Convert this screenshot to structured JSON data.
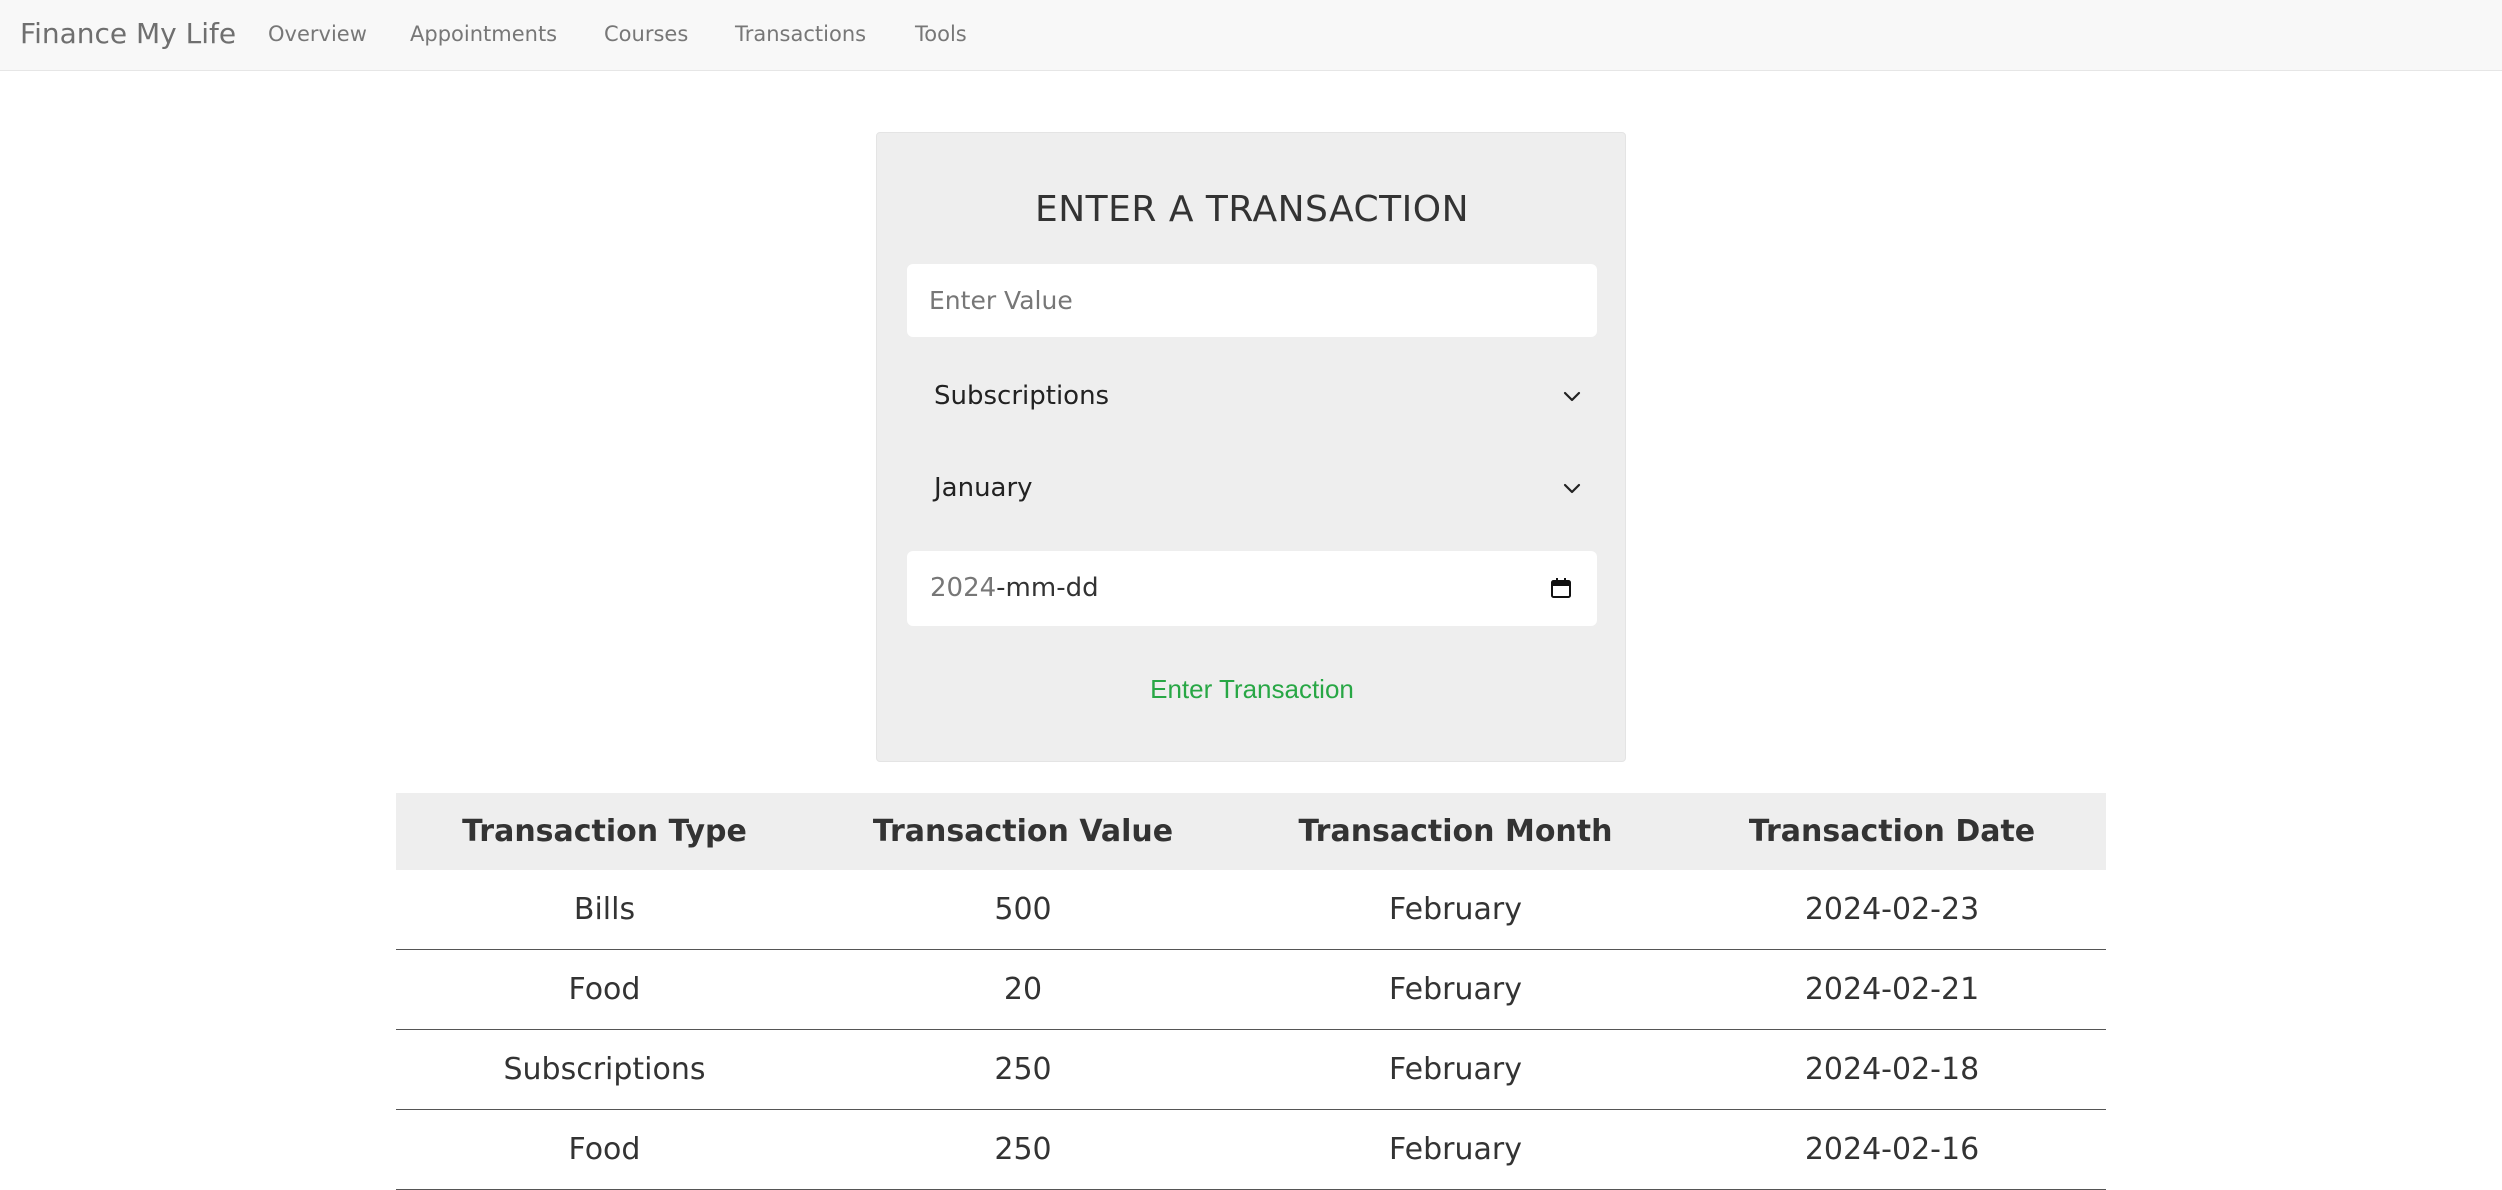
{
  "nav": {
    "brand": "Finance My Life",
    "links": [
      "Overview",
      "Appointments",
      "Courses",
      "Transactions",
      "Tools"
    ]
  },
  "form": {
    "title": "ENTER A TRANSACTION",
    "value_placeholder": "Enter Value",
    "type_selected": "Subscriptions",
    "month_selected": "January",
    "date_year": "2024",
    "date_rest": "-mm-dd",
    "submit_label": "Enter Transaction",
    "icons": {
      "dropdown": "chevron-down-icon",
      "date": "calendar-icon"
    }
  },
  "table": {
    "headers": [
      "Transaction Type",
      "Transaction Value",
      "Transaction Month",
      "Transaction Date"
    ],
    "rows": [
      [
        "Bills",
        "500",
        "February",
        "2024-02-23"
      ],
      [
        "Food",
        "20",
        "February",
        "2024-02-21"
      ],
      [
        "Subscriptions",
        "250",
        "February",
        "2024-02-18"
      ],
      [
        "Food",
        "250",
        "February",
        "2024-02-16"
      ]
    ]
  },
  "colors": {
    "navbar_bg": "#f8f8f8",
    "card_bg": "#eeeeee",
    "accent_green": "#28a745",
    "table_header_bg": "#eeeeee"
  }
}
